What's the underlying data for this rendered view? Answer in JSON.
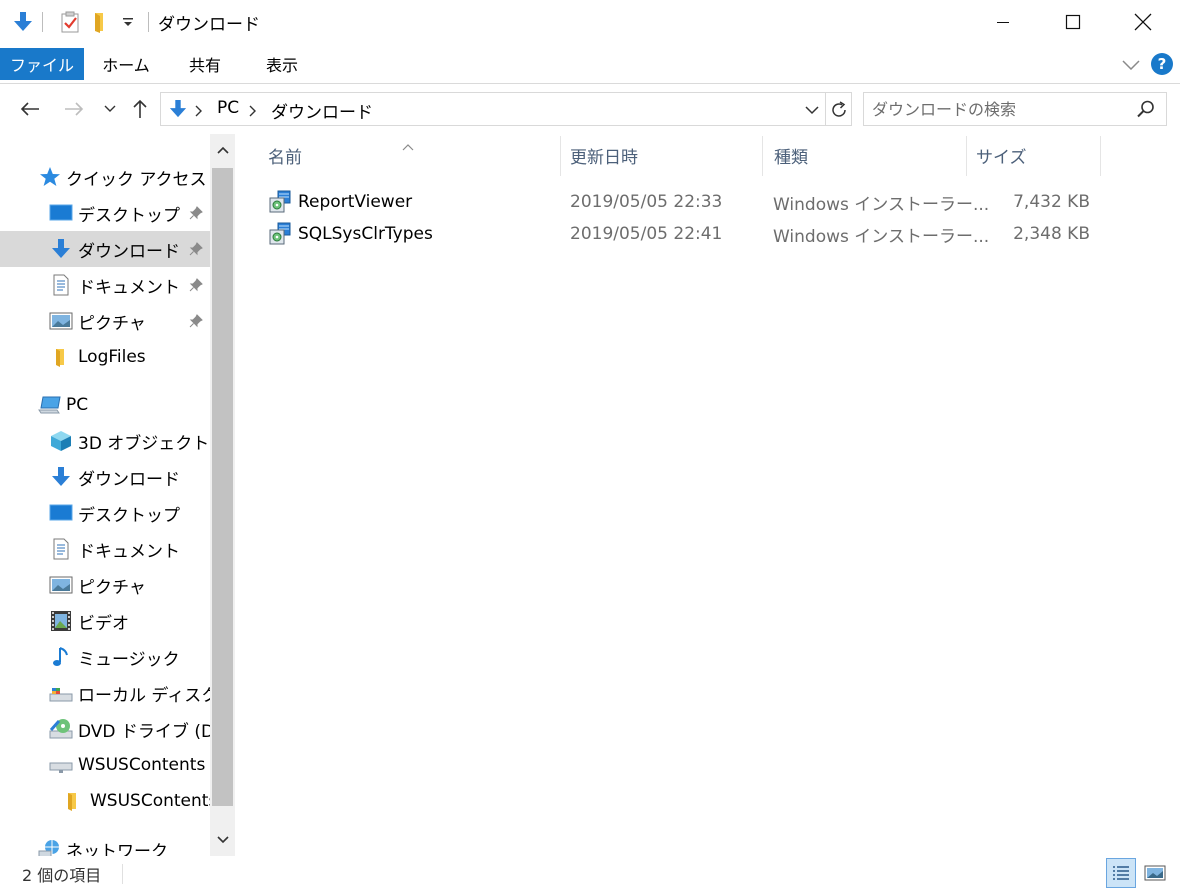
{
  "window": {
    "title": "ダウンロード",
    "minimize_icon": "minimize-icon",
    "maximize_icon": "maximize-icon",
    "close_icon": "close-icon"
  },
  "quick_access_toolbar": {
    "icons": [
      "download-arrow-icon",
      "properties-icon",
      "new-folder-icon",
      "customize-dropdown-icon"
    ]
  },
  "ribbon": {
    "tabs": [
      {
        "label": "ファイル",
        "active": true
      },
      {
        "label": "ホーム"
      },
      {
        "label": "共有"
      },
      {
        "label": "表示"
      }
    ],
    "accent_color": "#1979ca"
  },
  "navigation": {
    "address_path": [
      "PC",
      "ダウンロード"
    ],
    "search_placeholder": "ダウンロードの検索"
  },
  "nav_pane": {
    "quick_access": {
      "label": "クイック アクセス",
      "items": [
        {
          "label": "デスクトップ",
          "icon": "desktop-icon",
          "pinned": true
        },
        {
          "label": "ダウンロード",
          "icon": "download-arrow-icon",
          "pinned": true,
          "selected": true
        },
        {
          "label": "ドキュメント",
          "icon": "document-icon",
          "pinned": true
        },
        {
          "label": "ピクチャ",
          "icon": "picture-icon",
          "pinned": true
        },
        {
          "label": "LogFiles",
          "icon": "folder-icon",
          "pinned": false
        }
      ]
    },
    "this_pc": {
      "label": "PC",
      "items": [
        {
          "label": "3D オブジェクト",
          "icon": "3d-objects-icon"
        },
        {
          "label": "ダウンロード",
          "icon": "download-arrow-icon"
        },
        {
          "label": "デスクトップ",
          "icon": "desktop-icon"
        },
        {
          "label": "ドキュメント",
          "icon": "document-icon"
        },
        {
          "label": "ピクチャ",
          "icon": "picture-icon"
        },
        {
          "label": "ビデオ",
          "icon": "video-icon"
        },
        {
          "label": "ミュージック",
          "icon": "music-icon"
        },
        {
          "label": "ローカル ディスク (C:)",
          "icon": "local-disk-icon"
        },
        {
          "label": "DVD ドライブ (D:)",
          "icon": "dvd-drive-icon"
        },
        {
          "label": "WSUSContents (",
          "icon": "network-drive-icon"
        },
        {
          "label": "WSUSContents",
          "icon": "folder-icon"
        }
      ]
    },
    "network": {
      "label": "ネットワーク",
      "icon": "network-icon"
    }
  },
  "file_list": {
    "columns": {
      "name": "名前",
      "modified": "更新日時",
      "type": "種類",
      "size": "サイズ"
    },
    "sort_column": "name",
    "rows": [
      {
        "name": "ReportViewer",
        "modified": "2019/05/05 22:33",
        "type": "Windows インストーラー...",
        "size": "7,432 KB",
        "icon": "installer-package-icon"
      },
      {
        "name": "SQLSysClrTypes",
        "modified": "2019/05/05 22:41",
        "type": "Windows インストーラー...",
        "size": "2,348 KB",
        "icon": "installer-package-icon"
      }
    ]
  },
  "status_bar": {
    "item_count_text": "2 個の項目",
    "views": [
      "details-view-icon",
      "large-icons-view-icon"
    ],
    "active_view": "details-view-icon"
  }
}
